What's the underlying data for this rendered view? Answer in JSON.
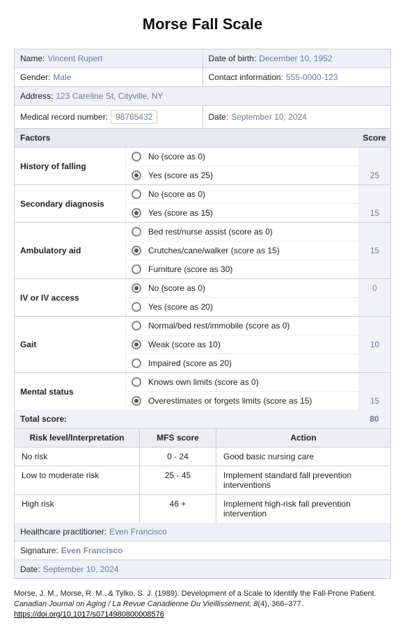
{
  "title": "Morse Fall Scale",
  "patient": {
    "name_label": "Name:",
    "name": "Vincent Rupert",
    "dob_label": "Date of birth:",
    "dob": "December 10, 1952",
    "gender_label": "Gender:",
    "gender": "Male",
    "contact_label": "Contact information:",
    "contact": "555-0000-123",
    "address_label": "Address:",
    "address": "123 Careline St, Cityville, NY",
    "mrn_label": "Medical record number:",
    "mrn": "98765432",
    "date_label": "Date:",
    "date": "September 10, 2024"
  },
  "headers": {
    "factors": "Factors",
    "score": "Score"
  },
  "factors": [
    {
      "label": "History of falling",
      "options": [
        {
          "text": "No (score as 0)",
          "selected": false,
          "score": ""
        },
        {
          "text": "Yes (score as 25)",
          "selected": true,
          "score": "25"
        }
      ]
    },
    {
      "label": "Secondary diagnosis",
      "options": [
        {
          "text": "No (score as 0)",
          "selected": false,
          "score": ""
        },
        {
          "text": "Yes (score as 15)",
          "selected": true,
          "score": "15"
        }
      ]
    },
    {
      "label": "Ambulatory aid",
      "options": [
        {
          "text": "Bed rest/nurse assist (score as 0)",
          "selected": false,
          "score": ""
        },
        {
          "text": "Crutches/cane/walker (score as 15)",
          "selected": true,
          "score": "15"
        },
        {
          "text": "Furniture (score as 30)",
          "selected": false,
          "score": ""
        }
      ]
    },
    {
      "label": "IV or IV access",
      "options": [
        {
          "text": "No (score as 0)",
          "selected": true,
          "score": "0"
        },
        {
          "text": "Yes (score as 20)",
          "selected": false,
          "score": ""
        }
      ]
    },
    {
      "label": "Gait",
      "options": [
        {
          "text": "Normal/bed rest/immobile (score as 0)",
          "selected": false,
          "score": ""
        },
        {
          "text": "Weak (score as 10)",
          "selected": true,
          "score": "10"
        },
        {
          "text": "Impaired (score as 20)",
          "selected": false,
          "score": ""
        }
      ]
    },
    {
      "label": "Mental status",
      "options": [
        {
          "text": "Knows own limits (score as 0)",
          "selected": false,
          "score": ""
        },
        {
          "text": "Overestimates or forgets limits (score as 15)",
          "selected": true,
          "score": "15"
        }
      ]
    }
  ],
  "total": {
    "label": "Total score:",
    "value": "80"
  },
  "risk": {
    "headers": {
      "level": "Risk level/Interpretation",
      "mfs": "MFS score",
      "action": "Action"
    },
    "rows": [
      {
        "level": "No risk",
        "mfs": "0 - 24",
        "action": "Good basic nursing care"
      },
      {
        "level": "Low to moderate risk",
        "mfs": "25 - 45",
        "action": "Implement standard fall prevention interventions"
      },
      {
        "level": "High risk",
        "mfs": "46 +",
        "action": "Implement high-risk fall prevention intervention"
      }
    ]
  },
  "signoff": {
    "practitioner_label": "Healthcare practitioner:",
    "practitioner": "Even Francisco",
    "signature_label": "Signature:",
    "signature": "Even Francisco",
    "date_label": "Date:",
    "date": "September 10, 2024"
  },
  "citation": {
    "authors": "Morse, J. M., Morse, R. M., & Tylko, S. J. (1989). Development of a Scale to Identify the Fall-Prone Patient. ",
    "journal": "Canadian Journal on Aging / La Revue Canadienne Du Vieillissement, 8",
    "rest": "(4), 366–377.",
    "doi": "https://doi.org/10.1017/s0714980800008576"
  }
}
